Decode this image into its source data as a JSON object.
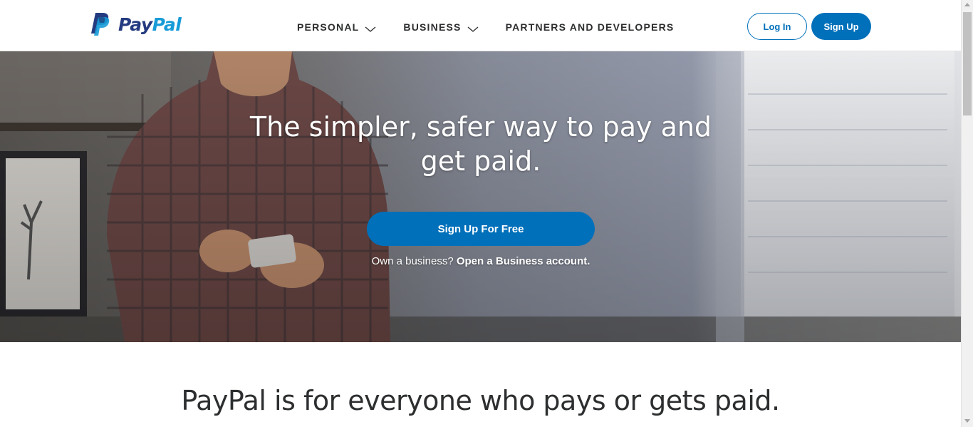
{
  "brand": {
    "name_part1": "Pay",
    "name_part2": "Pal",
    "colors": {
      "primary": "#0070ba",
      "dark_blue": "#253b80",
      "light_blue": "#179bd7"
    }
  },
  "nav": {
    "items": [
      {
        "label": "PERSONAL",
        "has_dropdown": true,
        "icon": "chevron-down-icon"
      },
      {
        "label": "BUSINESS",
        "has_dropdown": true,
        "icon": "chevron-down-icon"
      },
      {
        "label": "PARTNERS AND DEVELOPERS",
        "has_dropdown": false
      }
    ],
    "login_label": "Log In",
    "signup_label": "Sign Up"
  },
  "hero": {
    "title": "The simpler, safer way to pay and get paid.",
    "cta_label": "Sign Up For Free",
    "sub_text": "Own a business?",
    "sub_link": "Open a Business account."
  },
  "section": {
    "title": "PayPal is for everyone who pays or gets paid."
  }
}
